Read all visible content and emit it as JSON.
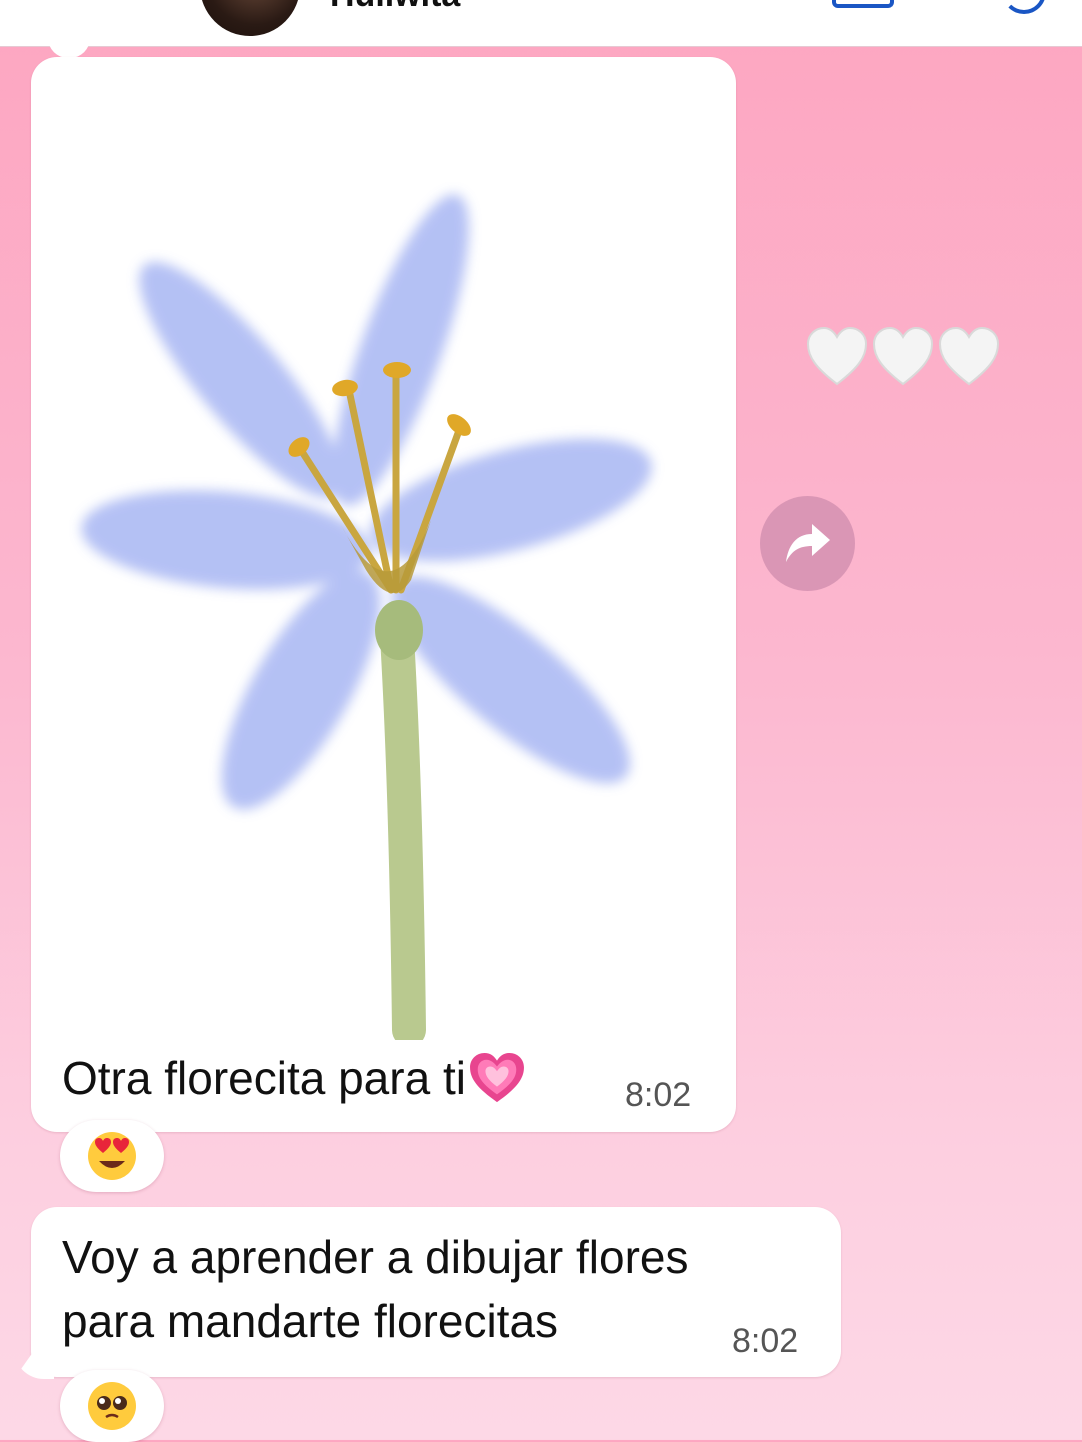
{
  "header": {
    "contact_name": "Huliwita"
  },
  "messages": [
    {
      "type": "image_with_caption",
      "image_description_icon": "flower-drawing",
      "caption": "Otra florecita para ti",
      "caption_emoji": "growing-heart-emoji",
      "time": "8:02",
      "reaction": "heart-eyes-emoji",
      "incoming": true
    },
    {
      "type": "text",
      "line1": "Voy a aprender a dibujar flores",
      "line2": "para mandarte florecitas",
      "time": "8:02",
      "reaction": "pleading-face-emoji",
      "incoming": true
    }
  ],
  "side_hearts": [
    "white-heart-emoji",
    "white-heart-emoji",
    "white-heart-emoji"
  ],
  "forward_icon": "forward-arrow-icon",
  "colors": {
    "background_top": "#fda6c1",
    "background_bottom": "#fdd8e6",
    "bubble": "#ffffff",
    "accent": "#1a56c4",
    "petal": "#9fb2f2",
    "stem": "#b8c98e"
  }
}
